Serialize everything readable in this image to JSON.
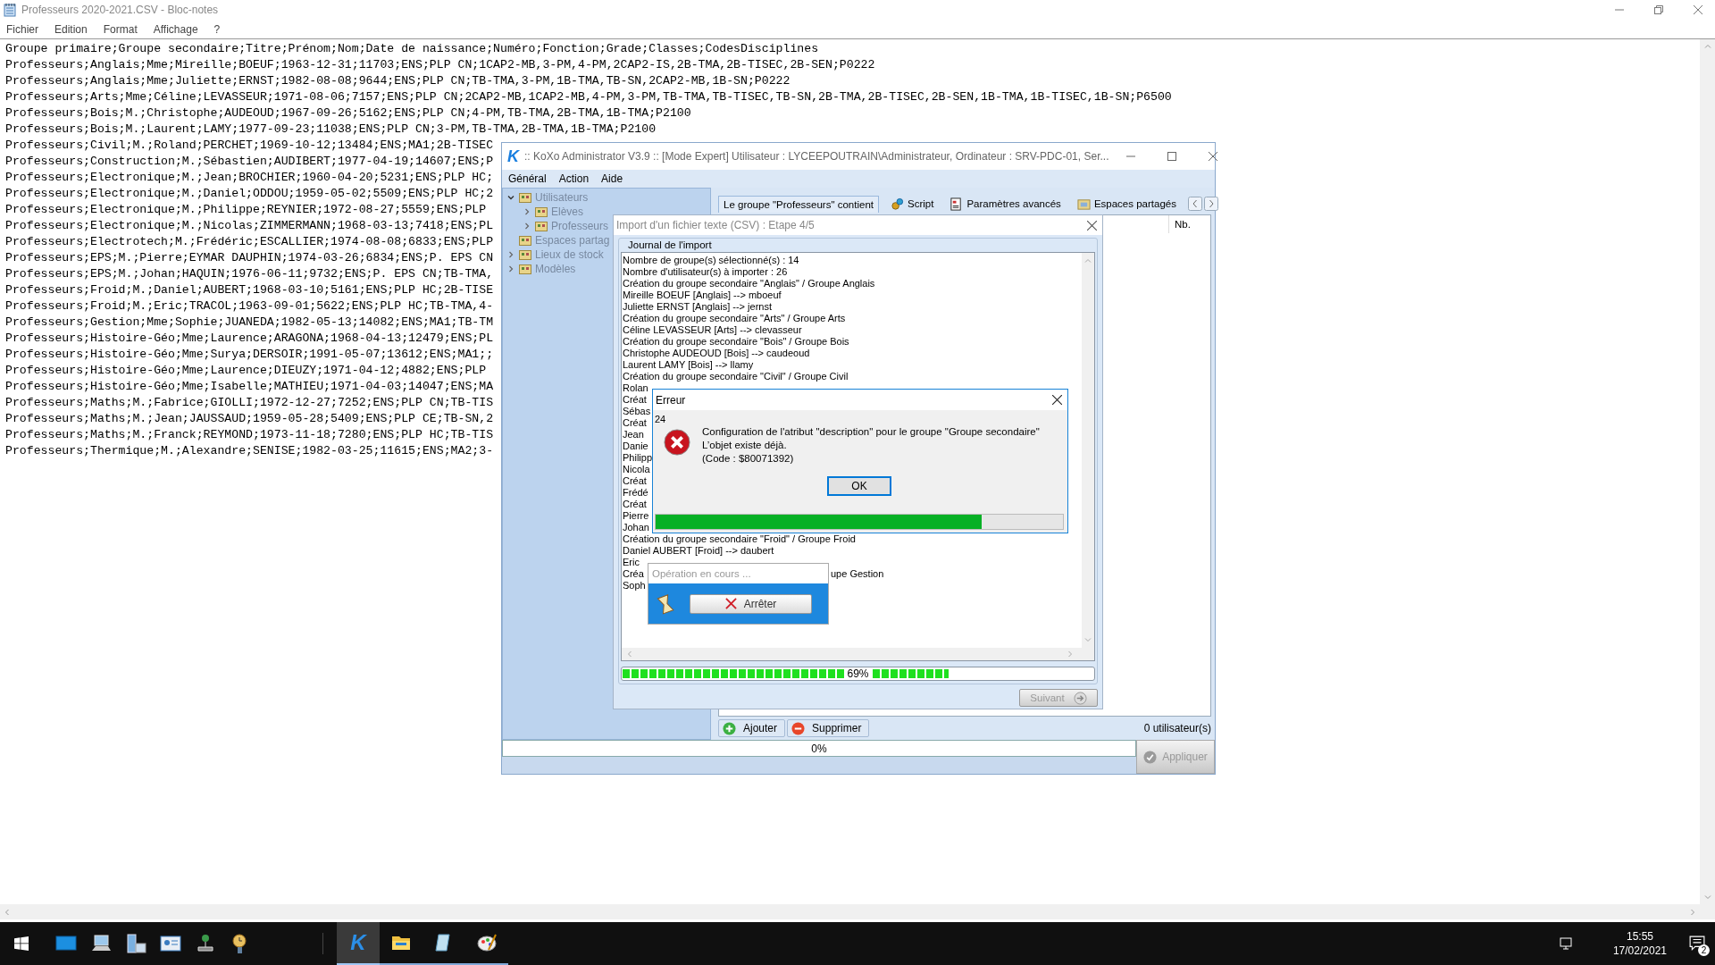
{
  "notepad": {
    "title": "Professeurs 2020-2021.CSV - Bloc-notes",
    "menu": [
      "Fichier",
      "Edition",
      "Format",
      "Affichage",
      "?"
    ],
    "lines": [
      "Groupe primaire;Groupe secondaire;Titre;Prénom;Nom;Date de naissance;Numéro;Fonction;Grade;Classes;CodesDisciplines",
      "Professeurs;Anglais;Mme;Mireille;BOEUF;1963-12-31;11703;ENS;PLP CN;1CAP2-MB,3-PM,4-PM,2CAP2-IS,2B-TMA,2B-TISEC,2B-SEN;P0222",
      "Professeurs;Anglais;Mme;Juliette;ERNST;1982-08-08;9644;ENS;PLP CN;TB-TMA,3-PM,1B-TMA,TB-SN,2CAP2-MB,1B-SN;P0222",
      "Professeurs;Arts;Mme;Céline;LEVASSEUR;1971-08-06;7157;ENS;PLP CN;2CAP2-MB,1CAP2-MB,4-PM,3-PM,TB-TMA,TB-TISEC,TB-SN,2B-TMA,2B-TISEC,2B-SEN,1B-TMA,1B-TISEC,1B-SN;P6500",
      "Professeurs;Bois;M.;Christophe;AUDEOUD;1967-09-26;5162;ENS;PLP CN;4-PM,TB-TMA,2B-TMA,1B-TMA;P2100",
      "Professeurs;Bois;M.;Laurent;LAMY;1977-09-23;11038;ENS;PLP CN;3-PM,TB-TMA,2B-TMA,1B-TMA;P2100",
      "Professeurs;Civil;M.;Roland;PERCHET;1969-10-12;13484;ENS;MA1;2B-TISEC",
      "Professeurs;Construction;M.;Sébastien;AUDIBERT;1977-04-19;14607;ENS;P",
      "Professeurs;Electronique;M.;Jean;BROCHIER;1960-04-20;5231;ENS;PLP HC;",
      "Professeurs;Electronique;M.;Daniel;ODDOU;1959-05-02;5509;ENS;PLP HC;2",
      "Professeurs;Electronique;M.;Philippe;REYNIER;1972-08-27;5559;ENS;PLP",
      "Professeurs;Electronique;M.;Nicolas;ZIMMERMANN;1968-03-13;7418;ENS;PL",
      "Professeurs;Electrotech;M.;Frédéric;ESCALLIER;1974-08-08;6833;ENS;PLP",
      "Professeurs;EPS;M.;Pierre;EYMAR DAUPHIN;1974-03-26;6834;ENS;P. EPS CN",
      "Professeurs;EPS;M.;Johan;HAQUIN;1976-06-11;9732;ENS;P. EPS CN;TB-TMA,",
      "Professeurs;Froid;M.;Daniel;AUBERT;1968-03-10;5161;ENS;PLP HC;2B-TISE",
      "Professeurs;Froid;M.;Eric;TRACOL;1963-09-01;5622;ENS;PLP HC;TB-TMA,4-",
      "Professeurs;Gestion;Mme;Sophie;JUANEDA;1982-05-13;14082;ENS;MA1;TB-TM",
      "Professeurs;Histoire-Géo;Mme;Laurence;ARAGONA;1968-04-13;12479;ENS;PL",
      "Professeurs;Histoire-Géo;Mme;Surya;DERSOIR;1991-05-07;13612;ENS;MA1;;",
      "Professeurs;Histoire-Géo;Mme;Laurence;DIEUZY;1971-04-12;4882;ENS;PLP",
      "Professeurs;Histoire-Géo;Mme;Isabelle;MATHIEU;1971-04-03;14047;ENS;MA",
      "Professeurs;Maths;M.;Fabrice;GIOLLI;1972-12-27;7252;ENS;PLP CN;TB-TIS",
      "Professeurs;Maths;M.;Jean;JAUSSAUD;1959-05-28;5409;ENS;PLP CE;TB-SN,2",
      "Professeurs;Maths;M.;Franck;REYMOND;1973-11-18;7280;ENS;PLP HC;TB-TIS",
      "Professeurs;Thermique;M.;Alexandre;SENISE;1982-03-25;11615;ENS;MA2;3-"
    ]
  },
  "koxo": {
    "logo": "K",
    "title": ":: KoXo Administrator V3.9 :: [Mode Expert] Utilisateur : LYCEEPOUTRAIN\\Administrateur, Ordinateur : SRV-PDC-01, Ser...",
    "menu": [
      "Général",
      "Action",
      "Aide"
    ],
    "tree": [
      {
        "label": "Utilisateurs",
        "expanded": true,
        "children": [
          {
            "label": "Elèves",
            "expanded": false
          },
          {
            "label": "Professeurs",
            "expanded": false
          }
        ]
      },
      {
        "label": "Espaces partag"
      },
      {
        "label": "Lieux de stock",
        "expanded": false
      },
      {
        "label": "Modèles",
        "expanded": false
      }
    ],
    "tabs": [
      {
        "label": "Le groupe \"Professeurs\" contient",
        "kind": "group",
        "selected": true
      },
      {
        "label": "Script",
        "kind": "script",
        "selected": false
      },
      {
        "label": "Paramètres avancés",
        "kind": "settings",
        "selected": false
      },
      {
        "label": "Espaces partagés",
        "kind": "shares",
        "selected": false
      }
    ],
    "list": {
      "columns": [
        "Nb."
      ]
    },
    "buttons": [
      {
        "label": "Ajouter",
        "kind": "add"
      },
      {
        "label": "Supprimer",
        "kind": "remove"
      }
    ],
    "count": "0 utilisateur(s)",
    "progress": {
      "level": 0,
      "label": "0%"
    },
    "apply_button": {
      "label": "Appliquer",
      "disabled": true
    }
  },
  "import_dialog": {
    "title": "Import d'un fichier texte (CSV) : Etape 4/5",
    "group_label": "Journal de l'import",
    "log": [
      {
        "text": "Nombre de groupe(s) sélectionné(s) : 14"
      },
      {
        "text": "Nombre d'utilisateur(s) à importer : 26"
      },
      {
        "text": "Création du groupe secondaire \"Anglais\" / Groupe Anglais"
      },
      {
        "text": "Mireille BOEUF [Anglais] --> mboeuf"
      },
      {
        "text": "Juliette ERNST [Anglais] --> jernst"
      },
      {
        "text": "Création du groupe secondaire \"Arts\" / Groupe Arts"
      },
      {
        "text": "Céline LEVASSEUR [Arts] --> clevasseur"
      },
      {
        "text": "Création du groupe secondaire \"Bois\" / Groupe Bois"
      },
      {
        "text": "Christophe AUDEOUD [Bois] --> caudeoud"
      },
      {
        "text": "Laurent LAMY [Bois] --> llamy"
      },
      {
        "text": "Création du groupe secondaire \"Civil\" / Groupe Civil"
      },
      {
        "text": "Rolan"
      },
      {
        "text": "Créat"
      },
      {
        "text": "Sébas"
      },
      {
        "text": "Créat"
      },
      {
        "text": "Jean"
      },
      {
        "text": "Danie"
      },
      {
        "text": "Philipp"
      },
      {
        "text": "Nicola"
      },
      {
        "text": "Créat"
      },
      {
        "text": "Frédé"
      },
      {
        "text": "Créat"
      },
      {
        "text": "Pierre"
      },
      {
        "text": "Johan"
      },
      {
        "text": "Création du groupe secondaire \"Froid\" / Groupe Froid"
      },
      {
        "text": "Daniel AUBERT [Froid] --> daubert"
      },
      {
        "text": "Eric"
      },
      {
        "text": "Créa",
        "tail": "upe Gestion"
      },
      {
        "text": "Soph"
      }
    ],
    "progress": {
      "level": 0.69,
      "label": "69%"
    },
    "next_button": {
      "label": "Suivant",
      "disabled": true
    }
  },
  "error_dialog": {
    "title": "Erreur",
    "number": "24",
    "message": [
      "Configuration de l'atribut \"description\" pour le groupe \"Groupe secondaire\"",
      "L’objet existe déjà.",
      "(Code : $80071392)"
    ],
    "ok_button": "OK",
    "progress": {
      "level": 0.8
    }
  },
  "operation_popup": {
    "title": "Opération en cours ...",
    "button": "Arrêter"
  },
  "taskbar": {
    "apps": [
      {
        "kind": "koxo",
        "letter": "K",
        "active": true
      },
      {
        "kind": "folder",
        "active": false
      },
      {
        "kind": "notepad",
        "active": false
      },
      {
        "kind": "paint",
        "active": false
      }
    ],
    "time": "15:55",
    "date": "17/02/2021",
    "notifications": "2"
  }
}
